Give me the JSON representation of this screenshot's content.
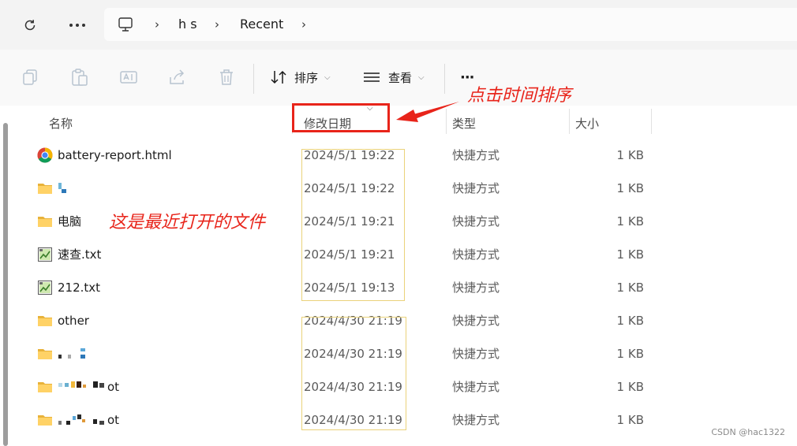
{
  "address": {
    "crumbs": [
      "h s",
      "Recent"
    ]
  },
  "toolbar": {
    "sort_label": "排序",
    "view_label": "查看",
    "more_label": "···"
  },
  "columns": {
    "name": "名称",
    "date": "修改日期",
    "type": "类型",
    "size": "大小"
  },
  "files": [
    {
      "name": "battery-report.html",
      "date": "2024/5/1 19:22",
      "type": "快捷方式",
      "size": "1 KB",
      "icon": "chrome-icon"
    },
    {
      "name": "",
      "date": "2024/5/1 19:22",
      "type": "快捷方式",
      "size": "1 KB",
      "icon": "folder-icon"
    },
    {
      "name": "电脑",
      "date": "2024/5/1 19:21",
      "type": "快捷方式",
      "size": "1 KB",
      "icon": "folder-icon"
    },
    {
      "name": "速查.txt",
      "date": "2024/5/1 19:21",
      "type": "快捷方式",
      "size": "1 KB",
      "icon": "text-file-icon"
    },
    {
      "name": "212.txt",
      "date": "2024/5/1 19:13",
      "type": "快捷方式",
      "size": "1 KB",
      "icon": "text-file-icon"
    },
    {
      "name": "other",
      "date": "2024/4/30 21:19",
      "type": "快捷方式",
      "size": "1 KB",
      "icon": "folder-icon"
    },
    {
      "name": "",
      "date": "2024/4/30 21:19",
      "type": "快捷方式",
      "size": "1 KB",
      "icon": "folder-icon"
    },
    {
      "name": "ot",
      "date": "2024/4/30 21:19",
      "type": "快捷方式",
      "size": "1 KB",
      "icon": "folder-icon"
    },
    {
      "name": "ot",
      "date": "2024/4/30 21:19",
      "type": "快捷方式",
      "size": "1 KB",
      "icon": "folder-icon"
    }
  ],
  "annotations": {
    "click_sort": "点击时间排序",
    "recent_files": "这是最近打开的文件",
    "color": "#e8241a"
  },
  "watermark": "CSDN @hac1322"
}
